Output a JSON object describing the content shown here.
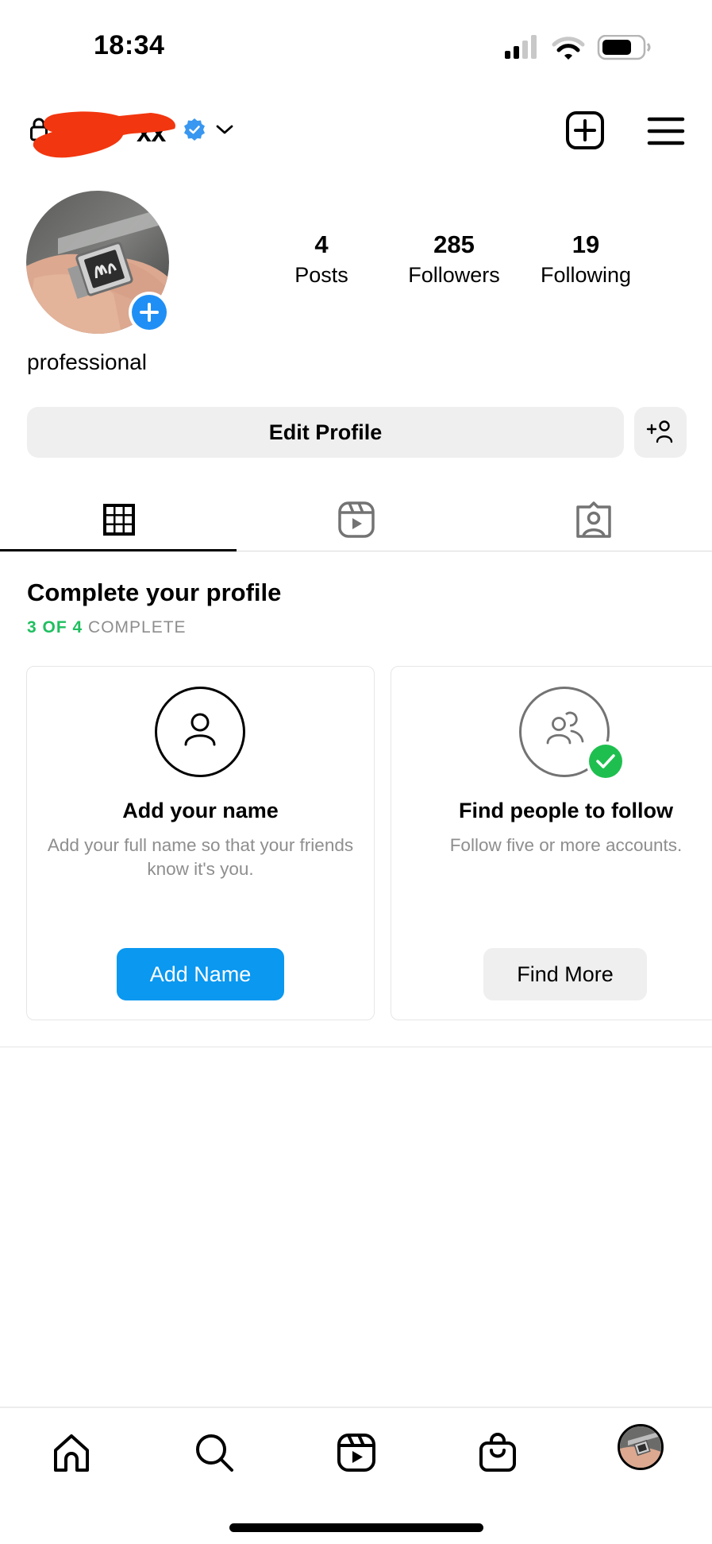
{
  "status_bar": {
    "time": "18:34",
    "signal_bars_filled": 2,
    "signal_bars_total": 4,
    "wifi_arcs_filled": 2,
    "wifi_arcs_total": 3,
    "battery_level": 0.75
  },
  "header": {
    "username_visible_suffix": "xx",
    "username_redacted": true,
    "verified": true,
    "icons": {
      "lock": "lock-icon",
      "verified": "verified-badge-icon",
      "switch_account": "chevron-down-icon",
      "new_post": "plus-square-icon",
      "menu": "hamburger-menu-icon"
    },
    "colors": {
      "verified": "#3897f0",
      "redaction": "#f2360f"
    }
  },
  "profile": {
    "avatar_description": "Hand wearing silver ring with calligraphy",
    "add_story_icon": "plus-icon",
    "category": "professional",
    "stats": [
      {
        "value": "4",
        "label": "Posts"
      },
      {
        "value": "285",
        "label": "Followers"
      },
      {
        "value": "19",
        "label": "Following"
      }
    ]
  },
  "actions": {
    "edit_profile": "Edit Profile",
    "discover_people_icon": "add-person-icon"
  },
  "tabs": [
    {
      "name": "posts-grid",
      "icon": "grid-icon",
      "active": true
    },
    {
      "name": "reels",
      "icon": "reels-icon",
      "active": false
    },
    {
      "name": "tagged",
      "icon": "tagged-person-icon",
      "active": false
    }
  ],
  "complete_profile": {
    "title": "Complete your profile",
    "progress_done": "3 OF 4",
    "progress_suffix": "COMPLETE",
    "progress_fraction": 0.75,
    "colors": {
      "progress_green": "#1fbf5f",
      "primary_blue": "#0a98f0",
      "check_green": "#1fbf4f"
    },
    "cards": [
      {
        "icon": "person-icon",
        "completed": false,
        "title": "Add your name",
        "description": "Add your full name so that your friends know it's you.",
        "button": "Add Name"
      },
      {
        "icon": "people-icon",
        "completed": true,
        "title": "Find people to follow",
        "description": "Follow five or more accounts.",
        "button": "Find More"
      }
    ]
  },
  "bottom_nav": [
    {
      "name": "home",
      "icon": "home-icon"
    },
    {
      "name": "search",
      "icon": "search-icon"
    },
    {
      "name": "reels",
      "icon": "reels-icon"
    },
    {
      "name": "shop",
      "icon": "shopping-bag-icon"
    },
    {
      "name": "profile",
      "icon": "profile-avatar"
    }
  ]
}
